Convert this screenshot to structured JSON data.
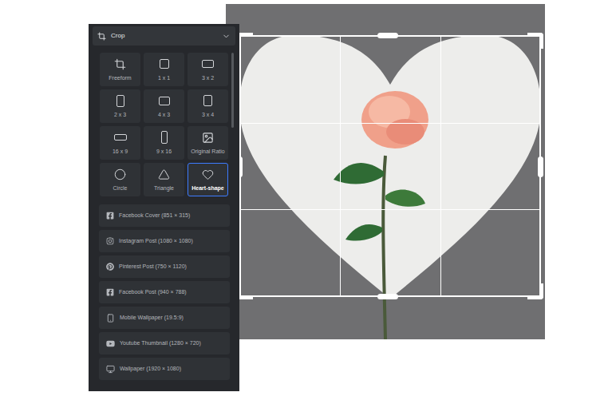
{
  "panel": {
    "title": "Crop"
  },
  "ratios": [
    {
      "label": "Freeform",
      "kind": "freeform",
      "selected": false
    },
    {
      "label": "1 x 1",
      "kind": "square",
      "selected": false
    },
    {
      "label": "3 x 2",
      "kind": "landscape",
      "selected": false
    },
    {
      "label": "2 x 3",
      "kind": "portrait",
      "selected": false
    },
    {
      "label": "4 x 3",
      "kind": "landscape43",
      "selected": false
    },
    {
      "label": "3 x 4",
      "kind": "portrait34",
      "selected": false
    },
    {
      "label": "16 x 9",
      "kind": "wide",
      "selected": false
    },
    {
      "label": "9 x 16",
      "kind": "tall",
      "selected": false
    },
    {
      "label": "Original Ratio",
      "kind": "image",
      "selected": false
    },
    {
      "label": "Circle",
      "kind": "circle",
      "selected": false
    },
    {
      "label": "Triangle",
      "kind": "triangle",
      "selected": false
    },
    {
      "label": "Heart-shape",
      "kind": "heart",
      "selected": true
    }
  ],
  "presets": [
    {
      "label": "Facebook Cover (851 × 315)",
      "kind": "facebook"
    },
    {
      "label": "Instagram Post (1080 × 1080)",
      "kind": "instagram"
    },
    {
      "label": "Pinterest Post (750 × 1120)",
      "kind": "pinterest"
    },
    {
      "label": "Facebook Post (940 × 788)",
      "kind": "facebook"
    },
    {
      "label": "Mobile Wallpaper (19.5:9)",
      "kind": "phone"
    },
    {
      "label": "Youtube Thumbnail (1280 × 720)",
      "kind": "youtube"
    },
    {
      "label": "Wallpaper (1920 × 1080)",
      "kind": "monitor"
    }
  ]
}
